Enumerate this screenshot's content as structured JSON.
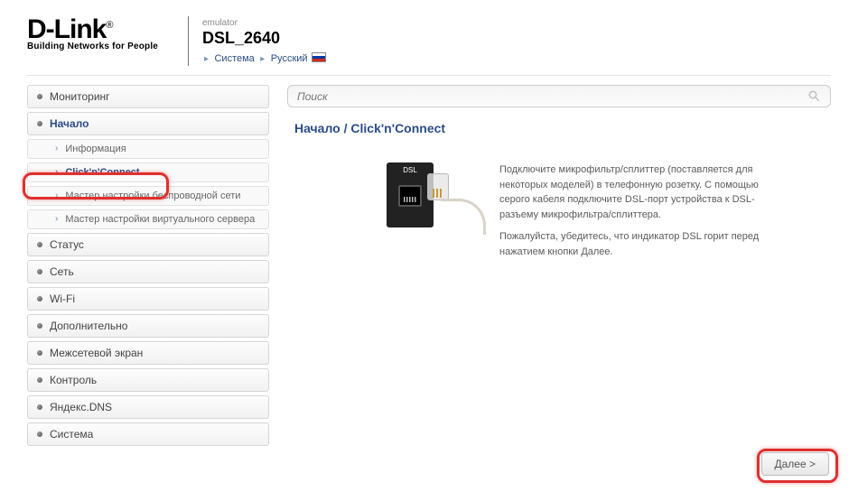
{
  "header": {
    "logo_main": "D-Link",
    "logo_sub": "Building Networks for People",
    "emulator_label": "emulator",
    "model": "DSL_2640",
    "crumb_system": "Система",
    "crumb_lang": "Русский"
  },
  "search": {
    "placeholder": "Поиск"
  },
  "sidebar": {
    "items": [
      {
        "label": "Мониторинг",
        "expanded": false
      },
      {
        "label": "Начало",
        "expanded": true
      },
      {
        "label": "Статус",
        "expanded": false
      },
      {
        "label": "Сеть",
        "expanded": false
      },
      {
        "label": "Wi-Fi",
        "expanded": false
      },
      {
        "label": "Дополнительно",
        "expanded": false
      },
      {
        "label": "Межсетевой экран",
        "expanded": false
      },
      {
        "label": "Контроль",
        "expanded": false
      },
      {
        "label": "Яндекс.DNS",
        "expanded": false
      },
      {
        "label": "Система",
        "expanded": false
      }
    ],
    "sub_items": [
      {
        "label": "Информация"
      },
      {
        "label": "Click'n'Connect"
      },
      {
        "label": "Мастер настройки беспроводной сети"
      },
      {
        "label": "Мастер настройки виртуального сервера"
      }
    ]
  },
  "main": {
    "breadcrumb": "Начало  /  Click'n'Connect",
    "dsl_label": "DSL",
    "para1": "Подключите микрофильтр/сплиттер (поставляется для некоторых моделей) в телефонную розетку. С помощью серого кабеля подключите DSL-порт устройства к DSL-разъему микрофильтра/сплиттера.",
    "para2": "Пожалуйста, убедитесь, что индикатор DSL горит перед нажатием кнопки Далее.",
    "next_label": "Далее >"
  }
}
